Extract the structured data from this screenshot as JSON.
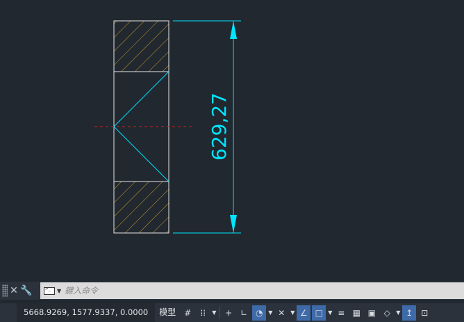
{
  "drawing": {
    "dimension_text": "629,27",
    "colors": {
      "background": "#212830",
      "outline": "#e6e6e6",
      "hatch": "#c9a227",
      "cyan": "#00e5ff",
      "centerline": "#d02020"
    }
  },
  "command_line": {
    "placeholder": "鍵入命令",
    "icons": [
      "grip-icon",
      "close-icon",
      "wrench-icon",
      "prompt-icon",
      "chevron-down-icon"
    ]
  },
  "status_bar": {
    "coordinates": "5668.9269, 1577.9337, 0.0000",
    "model_tab": "模型",
    "toggles": [
      {
        "name": "grid-icon",
        "glyph": "#",
        "on": false
      },
      {
        "name": "snap-icon",
        "glyph": "⁞⁞",
        "on": false
      },
      {
        "name": "infer-constraints-icon",
        "glyph": "+",
        "on": false
      },
      {
        "name": "ortho-icon",
        "glyph": "∟",
        "on": false
      },
      {
        "name": "polar-icon",
        "glyph": "◔",
        "on": true
      },
      {
        "name": "isodraft-icon",
        "glyph": "✕",
        "on": false
      },
      {
        "name": "osnap-tracking-icon",
        "glyph": "∠",
        "on": true
      },
      {
        "name": "osnap-icon",
        "glyph": "□",
        "on": true
      },
      {
        "name": "lineweight-icon",
        "glyph": "≡",
        "on": false
      },
      {
        "name": "transparency-icon",
        "glyph": "▦",
        "on": false
      },
      {
        "name": "selection-cycling-icon",
        "glyph": "▣",
        "on": false
      },
      {
        "name": "3d-osnap-icon",
        "glyph": "◇",
        "on": false
      },
      {
        "name": "dynamic-ucs-icon",
        "glyph": "↥",
        "on": true
      },
      {
        "name": "annotation-monitor-icon",
        "glyph": "⊡",
        "on": false
      }
    ]
  }
}
